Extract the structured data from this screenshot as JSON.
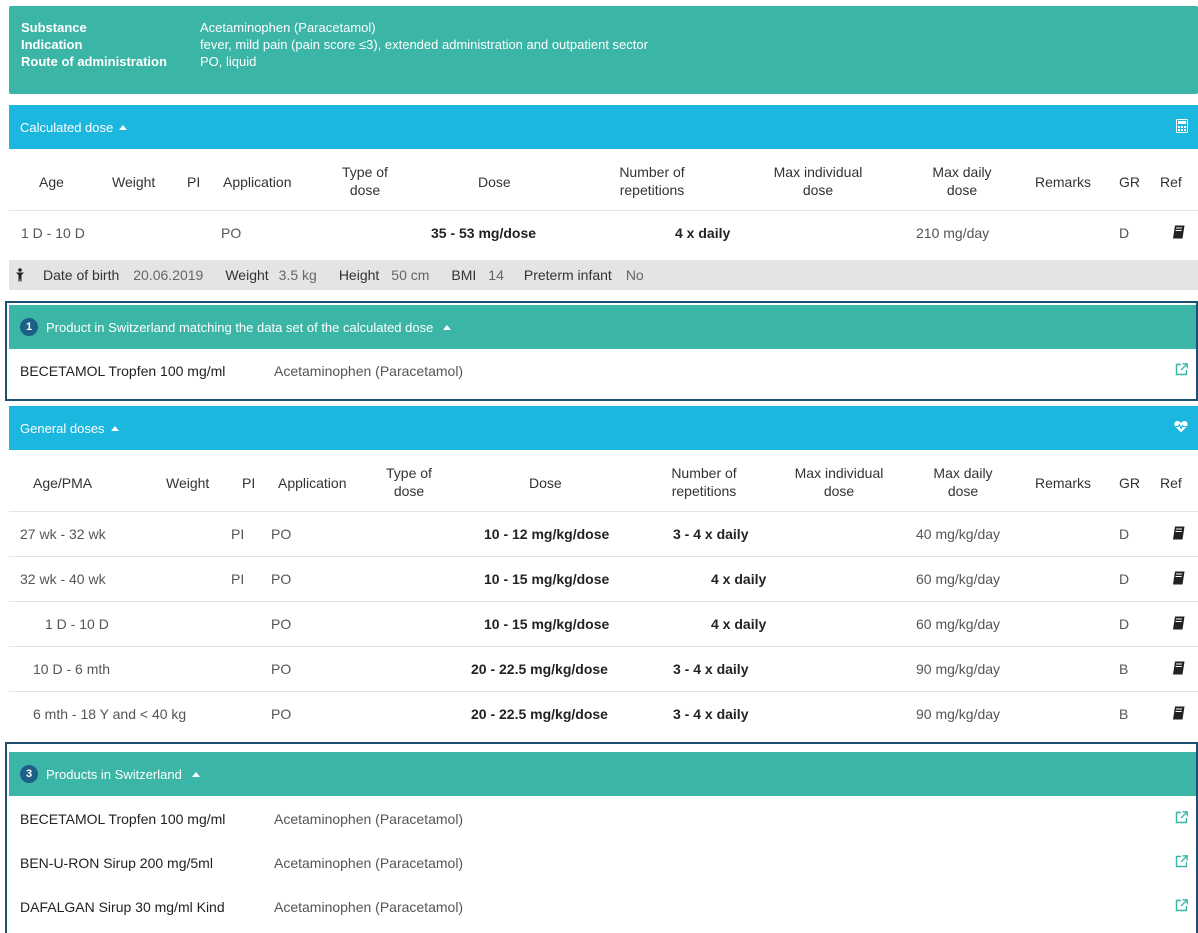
{
  "info": {
    "substance_label": "Substance",
    "substance_value": "Acetaminophen (Paracetamol)",
    "indication_label": "Indication",
    "indication_value": "fever, mild pain (pain score ≤3), extended administration and outpatient sector",
    "route_label": "Route of administration",
    "route_value": "PO, liquid"
  },
  "calculated": {
    "title": "Calculated dose",
    "icon": "calculator-icon",
    "headers": {
      "age": "Age",
      "weight": "Weight",
      "pi": "PI",
      "application": "Application",
      "type1": "Type of",
      "type2": "dose",
      "dose": "Dose",
      "rep1": "Number of",
      "rep2": "repetitions",
      "maxind1": "Max individual",
      "maxind2": "dose",
      "maxday1": "Max daily",
      "maxday2": "dose",
      "remarks": "Remarks",
      "gr": "GR",
      "ref": "Ref"
    },
    "row": {
      "age": "1 D - 10 D",
      "pi": "PO",
      "dose": "35 - 53 mg/dose",
      "repetitions": "4 x daily",
      "max_daily": "210 mg/day",
      "gr": "D"
    }
  },
  "patient": {
    "dob_label": "Date of birth",
    "dob": "20.06.2019",
    "weight_label": "Weight",
    "weight": "3.5 kg",
    "height_label": "Height",
    "height": "50 cm",
    "bmi_label": "BMI",
    "bmi": "14",
    "preterm_label": "Preterm infant",
    "preterm": "No"
  },
  "matching": {
    "count": "1",
    "title": "Product in Switzerland matching the data set of the calculated dose",
    "products": [
      {
        "name": "BECETAMOL Tropfen 100 mg/ml",
        "substance": "Acetaminophen (Paracetamol)"
      }
    ]
  },
  "general": {
    "title": "General doses",
    "icon": "heart-pulse-icon",
    "headers": {
      "age": "Age/PMA",
      "weight": "Weight",
      "pi": "PI",
      "application": "Application",
      "type1": "Type of",
      "type2": "dose",
      "dose": "Dose",
      "rep1": "Number of",
      "rep2": "repetitions",
      "maxind1": "Max individual",
      "maxind2": "dose",
      "maxday1": "Max daily",
      "maxday2": "dose",
      "remarks": "Remarks",
      "gr": "GR",
      "ref": "Ref"
    },
    "rows": [
      {
        "age": "27 wk - 32 wk",
        "pi": "PI",
        "app": "PO",
        "dose": "10 - 12 mg/kg/dose",
        "rep": "3 - 4 x daily",
        "maxday": "40 mg/kg/day",
        "gr": "D"
      },
      {
        "age": "32 wk - 40 wk",
        "pi": "PI",
        "app": "PO",
        "dose": "10 - 15 mg/kg/dose",
        "rep": "4 x daily",
        "maxday": "60 mg/kg/day",
        "gr": "D"
      },
      {
        "age": "1 D - 10 D",
        "pi": "",
        "app": "PO",
        "dose": "10 - 15 mg/kg/dose",
        "rep": "4 x daily",
        "maxday": "60 mg/kg/day",
        "gr": "D"
      },
      {
        "age": "10 D - 6 mth",
        "pi": "",
        "app": "PO",
        "dose": "20 - 22.5 mg/kg/dose",
        "rep": "3 - 4 x daily",
        "maxday": "90 mg/kg/day",
        "gr": "B"
      },
      {
        "age": "6 mth - 18 Y and < 40 kg",
        "pi": "",
        "app": "PO",
        "dose": "20 - 22.5 mg/kg/dose",
        "rep": "3 - 4 x daily",
        "maxday": "90 mg/kg/day",
        "gr": "B"
      }
    ]
  },
  "swiss": {
    "count": "3",
    "title": "Products in Switzerland",
    "products": [
      {
        "name": "BECETAMOL Tropfen 100 mg/ml",
        "substance": "Acetaminophen (Paracetamol)"
      },
      {
        "name": "BEN-U-RON Sirup 200 mg/5ml",
        "substance": "Acetaminophen (Paracetamol)"
      },
      {
        "name": "DAFALGAN Sirup 30 mg/ml Kind",
        "substance": "Acetaminophen (Paracetamol)"
      }
    ]
  },
  "colors": {
    "teal": "#3bb5a6",
    "blue": "#1bb7df",
    "navy": "#1d4f73",
    "grey": "#e4e4e4"
  }
}
